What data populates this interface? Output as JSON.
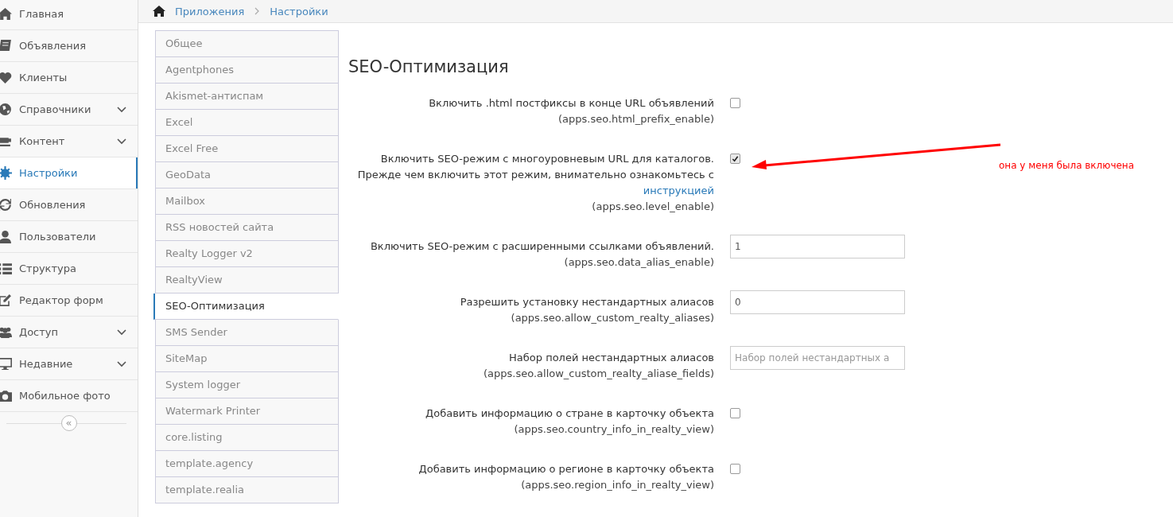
{
  "sidebar": {
    "items": [
      {
        "label": "Главная",
        "selected": false,
        "expandable": false
      },
      {
        "label": "Объявления",
        "selected": false,
        "expandable": false
      },
      {
        "label": "Клиенты",
        "selected": false,
        "expandable": false
      },
      {
        "label": "Справочники",
        "selected": false,
        "expandable": true
      },
      {
        "label": "Контент",
        "selected": false,
        "expandable": true
      },
      {
        "label": "Настройки",
        "selected": true,
        "expandable": false
      },
      {
        "label": "Обновления",
        "selected": false,
        "expandable": false
      },
      {
        "label": "Пользователи",
        "selected": false,
        "expandable": false
      },
      {
        "label": "Структура",
        "selected": false,
        "expandable": false
      },
      {
        "label": "Редактор форм",
        "selected": false,
        "expandable": false
      },
      {
        "label": "Доступ",
        "selected": false,
        "expandable": true
      },
      {
        "label": "Недавние",
        "selected": false,
        "expandable": true
      },
      {
        "label": "Мобильное фото",
        "selected": false,
        "expandable": false
      }
    ],
    "collapse": "«"
  },
  "breadcrumb": [
    "Приложения",
    "Настройки"
  ],
  "tabs": [
    {
      "label": "Общее",
      "selected": false
    },
    {
      "label": "Agentphones",
      "selected": false
    },
    {
      "label": "Akismet-антиспам",
      "selected": false
    },
    {
      "label": "Excel",
      "selected": false
    },
    {
      "label": "Excel Free",
      "selected": false
    },
    {
      "label": "GeoData",
      "selected": false
    },
    {
      "label": "Mailbox",
      "selected": false
    },
    {
      "label": "RSS новостей сайта",
      "selected": false
    },
    {
      "label": "Realty Logger v2",
      "selected": false
    },
    {
      "label": "RealtyView",
      "selected": false
    },
    {
      "label": "SEO-Оптимизация",
      "selected": true
    },
    {
      "label": "SMS Sender",
      "selected": false
    },
    {
      "label": "SiteMap",
      "selected": false
    },
    {
      "label": "System logger",
      "selected": false
    },
    {
      "label": "Watermark Printer",
      "selected": false
    },
    {
      "label": "core.listing",
      "selected": false
    },
    {
      "label": "template.agency",
      "selected": false
    },
    {
      "label": "template.realia",
      "selected": false
    }
  ],
  "section_title": "SEO-Оптимизация",
  "settings": [
    {
      "kind": "checkbox",
      "label": "Включить .html постфиксы в конце URL объявлений",
      "key": "(apps.seo.html_prefix_enable)",
      "checked": false
    },
    {
      "kind": "checkbox",
      "label": "Включить SEO-режим с многоуровневым URL для каталогов. Прежде чем включить этот режим, внимательно ознакомьтесь с",
      "link": "инструкцией",
      "key": "(apps.seo.level_enable)",
      "checked": true
    },
    {
      "kind": "input",
      "label": "Включить SEO-режим с расширенными ссылками объявлений.",
      "key": "(apps.seo.data_alias_enable)",
      "value": "1"
    },
    {
      "kind": "input",
      "label": "Разрешить установку нестандартных алиасов",
      "key": "(apps.seo.allow_custom_realty_aliases)",
      "value": "0"
    },
    {
      "kind": "input",
      "label": "Набор полей нестандартных алиасов",
      "key": "(apps.seo.allow_custom_realty_aliase_fields)",
      "placeholder": "Набор полей нестандартных а"
    },
    {
      "kind": "checkbox",
      "label": "Добавить информацию о стране в карточку объекта",
      "key": "(apps.seo.country_info_in_realty_view)",
      "checked": false
    },
    {
      "kind": "checkbox",
      "label": "Добавить информацию о регионе в карточку объекта",
      "key": "(apps.seo.region_info_in_realty_view)",
      "checked": false
    }
  ],
  "annotation": {
    "text": "она у меня была включена",
    "color": "#ff0000"
  }
}
